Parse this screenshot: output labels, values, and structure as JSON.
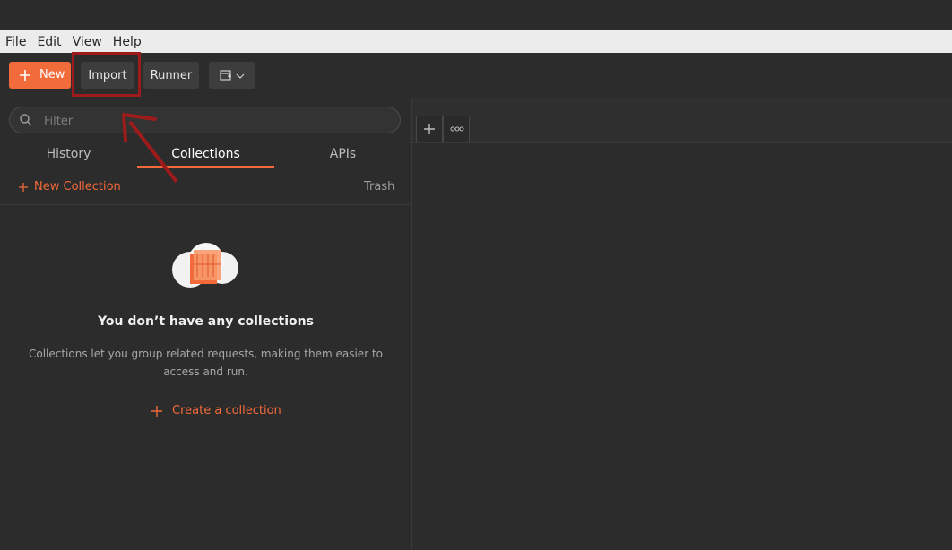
{
  "menu": {
    "items": [
      "File",
      "Edit",
      "View",
      "Help"
    ]
  },
  "toolbar": {
    "new_label": "New",
    "import_label": "Import",
    "runner_label": "Runner"
  },
  "sidebar": {
    "filter_placeholder": "Filter",
    "tabs": [
      "History",
      "Collections",
      "APIs"
    ],
    "active_tab": "Collections",
    "new_collection_label": "New Collection",
    "trash_label": "Trash",
    "empty_title": "You don’t have any collections",
    "empty_desc": "Collections let you group related requests, making them easier to access and run.",
    "create_link_label": "Create a collection"
  },
  "colors": {
    "accent": "#f26b3a",
    "annotation": "#9e1b1b"
  },
  "icons": [
    "plus-icon",
    "search-icon",
    "new-window-icon",
    "chevron-down-icon",
    "more-icon",
    "collection-illustration"
  ]
}
